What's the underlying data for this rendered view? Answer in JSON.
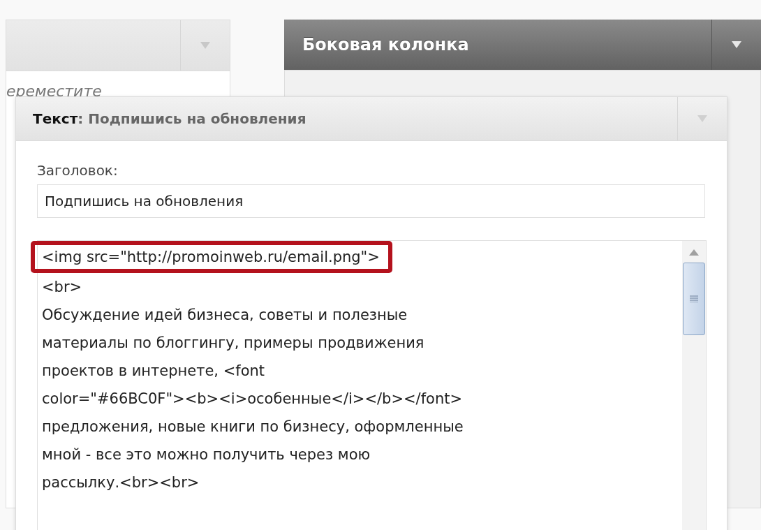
{
  "left_panel": {
    "hint": "ереместите"
  },
  "sidebar": {
    "title": "Боковая колонка"
  },
  "widget": {
    "type_label": "Текст",
    "separator": ":",
    "title": "Подпишись на обновления",
    "field_label": "Заголовок:",
    "field_value": "Подпишись на обновления",
    "content_lines": [
      {
        "text": "<img src=\"http://promoinweb.ru/email.png\">",
        "highlighted": true
      },
      {
        "text": "<br>",
        "highlighted": false
      },
      {
        "text": "Обсуждение идей бизнеса, советы и полезные",
        "highlighted": false
      },
      {
        "text": "материалы по блоггингу, примеры продвижения",
        "highlighted": false
      },
      {
        "text": "проектов в интернете, <font",
        "highlighted": false
      },
      {
        "text": "color=\"#66BC0F\"><b><i>особенные</i></b></font>",
        "highlighted": false
      },
      {
        "text": "предложения, новые книги по бизнесу, оформленные",
        "highlighted": false
      },
      {
        "text": "мной - все это можно получить через мою",
        "highlighted": false
      },
      {
        "text": "рассылку.<br><br>",
        "highlighted": false
      }
    ]
  }
}
